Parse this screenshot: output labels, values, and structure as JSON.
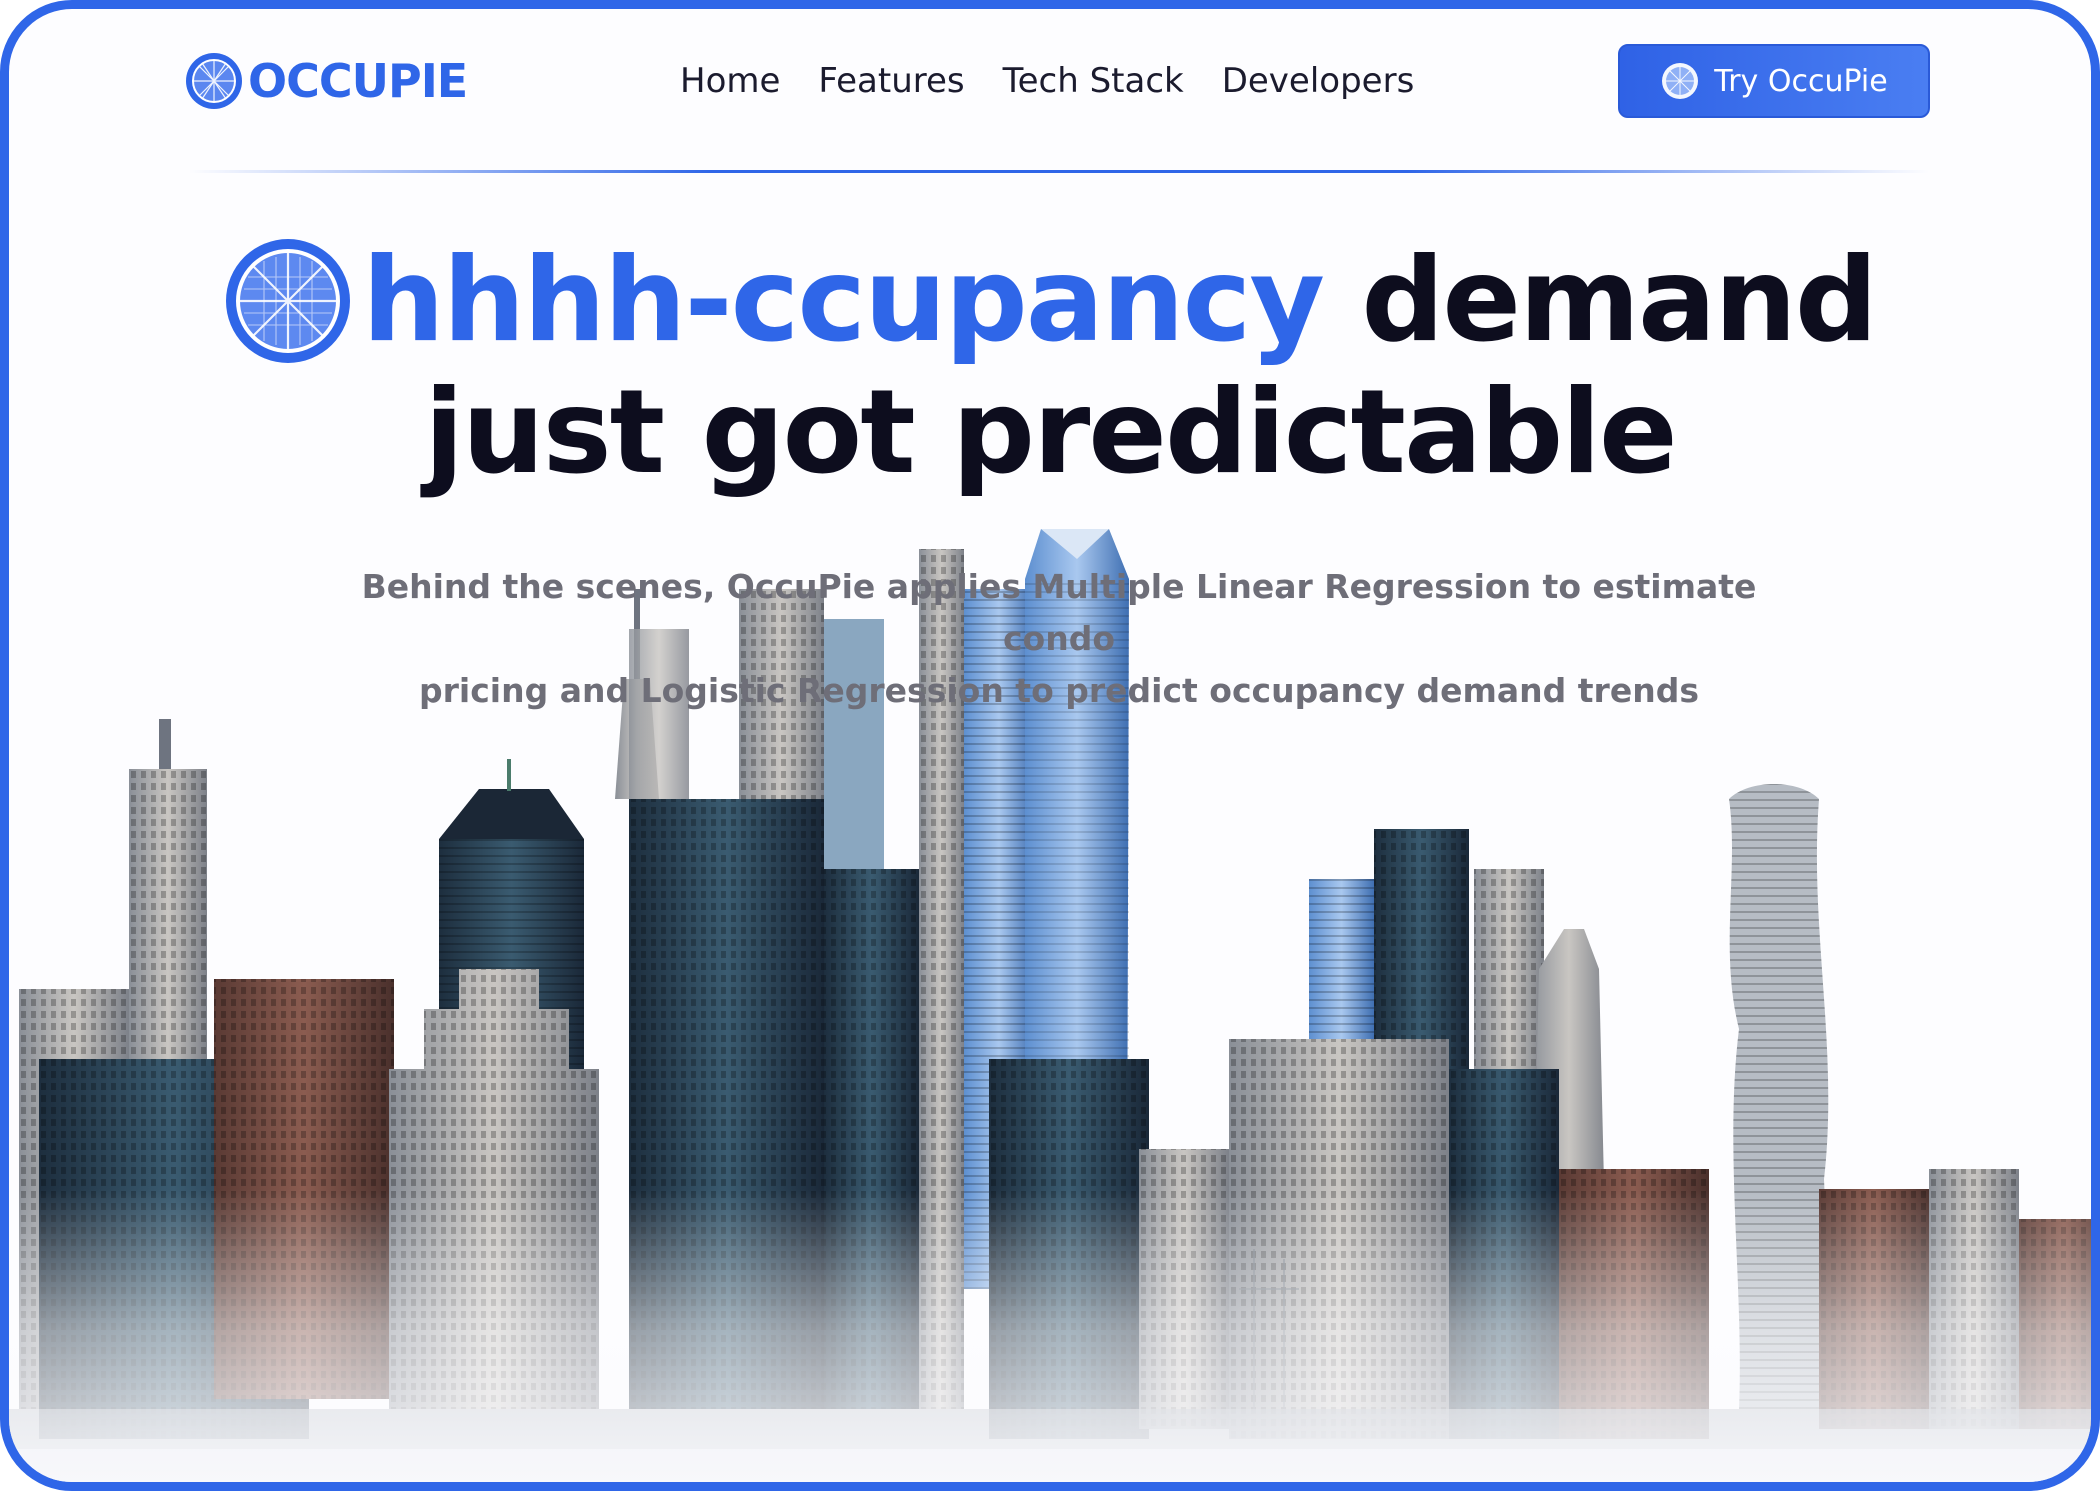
{
  "nav": {
    "logo_text": "OCCUPIE",
    "links": [
      "Home",
      "Features",
      "Tech Stack",
      "Developers"
    ],
    "cta_label": "Try OccuPie"
  },
  "hero": {
    "headline_accent": "hhhh-ccupancy",
    "headline_rest": "demand",
    "headline_line2": "just got predictable",
    "subtext_line1": "Behind the scenes, OccuPie applies Multiple Linear Regression to estimate condo",
    "subtext_line2": "pricing and Logistic Regression to predict occupancy demand trends"
  },
  "colors": {
    "brand": "#2f66e8",
    "headline": "#0d0d1e",
    "subtext": "#6e6e78"
  },
  "icons": {
    "logo": "pie-grid-icon",
    "headline": "pie-grid-icon",
    "cta": "pie-grid-icon"
  },
  "images": {
    "hero": "city-skyline-image"
  }
}
